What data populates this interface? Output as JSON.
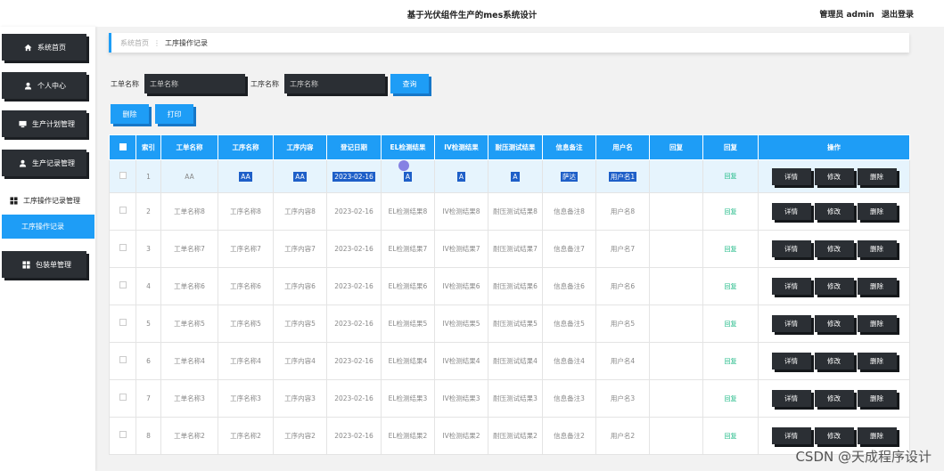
{
  "header": {
    "title": "基于光伏组件生产的mes系统设计",
    "user_label": "管理员 admin",
    "logout_label": "退出登录"
  },
  "sidebar": {
    "items": [
      {
        "label": "系统首页",
        "icon": "home-icon"
      },
      {
        "label": "个人中心",
        "icon": "user-icon"
      },
      {
        "label": "生产计划管理",
        "icon": "monitor-icon"
      },
      {
        "label": "生产记录管理",
        "icon": "user-icon"
      },
      {
        "label": "工序操作记录管理",
        "icon": "grid-icon"
      },
      {
        "label": "工序操作记录",
        "icon": ""
      },
      {
        "label": "包装单管理",
        "icon": "grid-icon"
      }
    ]
  },
  "breadcrumb": {
    "home": "系统首页",
    "separator": "⋮",
    "current": "工序操作记录"
  },
  "search": {
    "field1_label": "工单名称",
    "field1_placeholder": "工单名称",
    "field2_label": "工序名称",
    "field2_placeholder": "工序名称",
    "query_label": "查询",
    "delete_label": "删除",
    "print_label": "打印"
  },
  "table": {
    "columns": [
      "索引",
      "工单名称",
      "工序名称",
      "工序内容",
      "登记日期",
      "EL检测结果",
      "IV检测结果",
      "耐压测试结果",
      "信息备注",
      "用户名",
      "回复",
      "回复",
      "操作"
    ],
    "rows": [
      {
        "index": "1",
        "order": "AA",
        "process": "AA",
        "content": "AA",
        "date": "2023-02-16",
        "el": "A",
        "iv": "A",
        "pressure": "A",
        "note": "萨达",
        "user": "用户名1",
        "reply": "回复"
      },
      {
        "index": "2",
        "order": "工单名称8",
        "process": "工序名称8",
        "content": "工序内容8",
        "date": "2023-02-16",
        "el": "EL检测结果8",
        "iv": "IV检测结果8",
        "pressure": "耐压测试结果8",
        "note": "信息备注8",
        "user": "用户名8",
        "reply": "回复"
      },
      {
        "index": "3",
        "order": "工单名称7",
        "process": "工序名称7",
        "content": "工序内容7",
        "date": "2023-02-16",
        "el": "EL检测结果7",
        "iv": "IV检测结果7",
        "pressure": "耐压测试结果7",
        "note": "信息备注7",
        "user": "用户名7",
        "reply": "回复"
      },
      {
        "index": "4",
        "order": "工单名称6",
        "process": "工序名称6",
        "content": "工序内容6",
        "date": "2023-02-16",
        "el": "EL检测结果6",
        "iv": "IV检测结果6",
        "pressure": "耐压测试结果6",
        "note": "信息备注6",
        "user": "用户名6",
        "reply": "回复"
      },
      {
        "index": "5",
        "order": "工单名称5",
        "process": "工序名称5",
        "content": "工序内容5",
        "date": "2023-02-16",
        "el": "EL检测结果5",
        "iv": "IV检测结果5",
        "pressure": "耐压测试结果5",
        "note": "信息备注5",
        "user": "用户名5",
        "reply": "回复"
      },
      {
        "index": "6",
        "order": "工单名称4",
        "process": "工序名称4",
        "content": "工序内容4",
        "date": "2023-02-16",
        "el": "EL检测结果4",
        "iv": "IV检测结果4",
        "pressure": "耐压测试结果4",
        "note": "信息备注4",
        "user": "用户名4",
        "reply": "回复"
      },
      {
        "index": "7",
        "order": "工单名称3",
        "process": "工序名称3",
        "content": "工序内容3",
        "date": "2023-02-16",
        "el": "EL检测结果3",
        "iv": "IV检测结果3",
        "pressure": "耐压测试结果3",
        "note": "信息备注3",
        "user": "用户名3",
        "reply": "回复"
      },
      {
        "index": "8",
        "order": "工单名称2",
        "process": "工序名称2",
        "content": "工序内容2",
        "date": "2023-02-16",
        "el": "EL检测结果2",
        "iv": "IV检测结果2",
        "pressure": "耐压测试结果2",
        "note": "信息备注2",
        "user": "用户名2",
        "reply": "回复"
      }
    ],
    "actions": {
      "detail": "详情",
      "edit": "修改",
      "delete": "删除"
    }
  },
  "watermark": "CSDN @天成程序设计",
  "colors": {
    "accent": "#1e9df6",
    "dark": "#2b2f34",
    "reply": "#22bb88"
  }
}
